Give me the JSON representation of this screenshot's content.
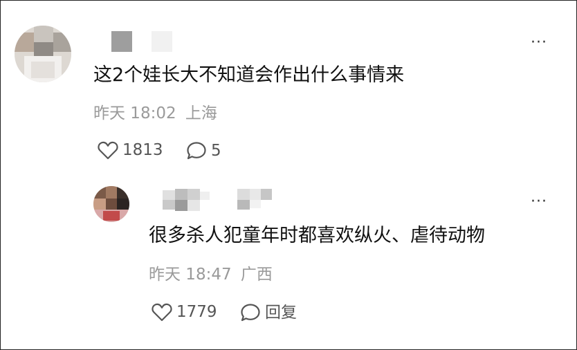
{
  "comments": [
    {
      "text": "这2个娃长大不知道会作出什么事情来",
      "time": "昨天 18:02",
      "location": "上海",
      "likes": "1813",
      "replies": "5",
      "more": "···"
    },
    {
      "text": "很多杀人犯童年时都喜欢纵火、虐待动物",
      "time": "昨天 18:47",
      "location": "广西",
      "likes": "1779",
      "reply_label": "回复",
      "more": "···"
    }
  ],
  "icons": {
    "like": "heart-outline-icon",
    "comment": "speech-bubble-icon",
    "more": "more-horizontal-icon"
  },
  "colors": {
    "text": "#111111",
    "meta": "#9a9a9a",
    "icon": "#555555",
    "border": "#222222"
  }
}
